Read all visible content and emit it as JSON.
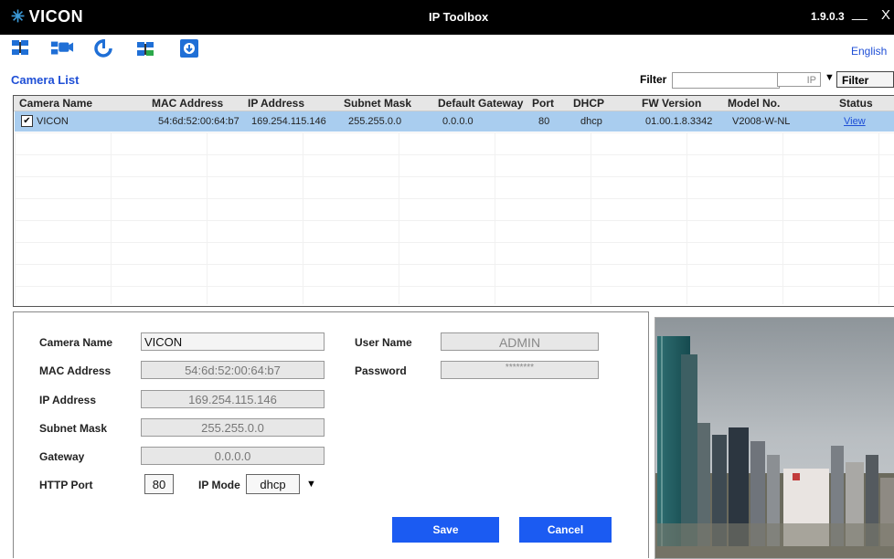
{
  "titlebar": {
    "brand": "VICON",
    "title": "IP Toolbox",
    "version": "1.9.0.3",
    "minimize": "__",
    "close": "X"
  },
  "toolbar": {
    "icons": [
      "search-camera-icon",
      "camera-list-icon",
      "refresh-icon",
      "network-config-icon",
      "firmware-upgrade-icon"
    ],
    "language": "English"
  },
  "camera_list": {
    "title": "Camera List",
    "filter_label": "Filter",
    "filter_value": "",
    "filter_type": "IP",
    "filter_button": "Filter",
    "columns": [
      "Camera Name",
      "MAC Address",
      "IP Address",
      "Subnet Mask",
      "Default Gateway",
      "Port",
      "DHCP",
      "FW Version",
      "Model No.",
      "Status"
    ],
    "rows": [
      {
        "checked": true,
        "camera_name": "VICON",
        "mac": "54:6d:52:00:64:b7",
        "ip": "169.254.115.146",
        "subnet": "255.255.0.0",
        "gateway": "0.0.0.0",
        "port": "80",
        "dhcp": "dhcp",
        "fw": "01.00.1.8.3342",
        "model": "V2008-W-NL",
        "status": "View"
      }
    ]
  },
  "form": {
    "camera_name_label": "Camera Name",
    "camera_name": "VICON",
    "mac_label": "MAC Address",
    "mac": "54:6d:52:00:64:b7",
    "ip_label": "IP Address",
    "ip": "169.254.115.146",
    "subnet_label": "Subnet Mask",
    "subnet": "255.255.0.0",
    "gateway_label": "Gateway",
    "gateway": "0.0.0.0",
    "http_port_label": "HTTP Port",
    "http_port": "80",
    "ip_mode_label": "IP Mode",
    "ip_mode": "dhcp",
    "user_name_label": "User Name",
    "user_name": "ADMIN",
    "password_label": "Password",
    "password": "********",
    "save": "Save",
    "cancel": "Cancel"
  },
  "colors": {
    "accent_blue": "#1b5bf2",
    "selected_row": "#a9cdef",
    "titlebar": "#000000",
    "link_blue": "#1f4fd6"
  }
}
